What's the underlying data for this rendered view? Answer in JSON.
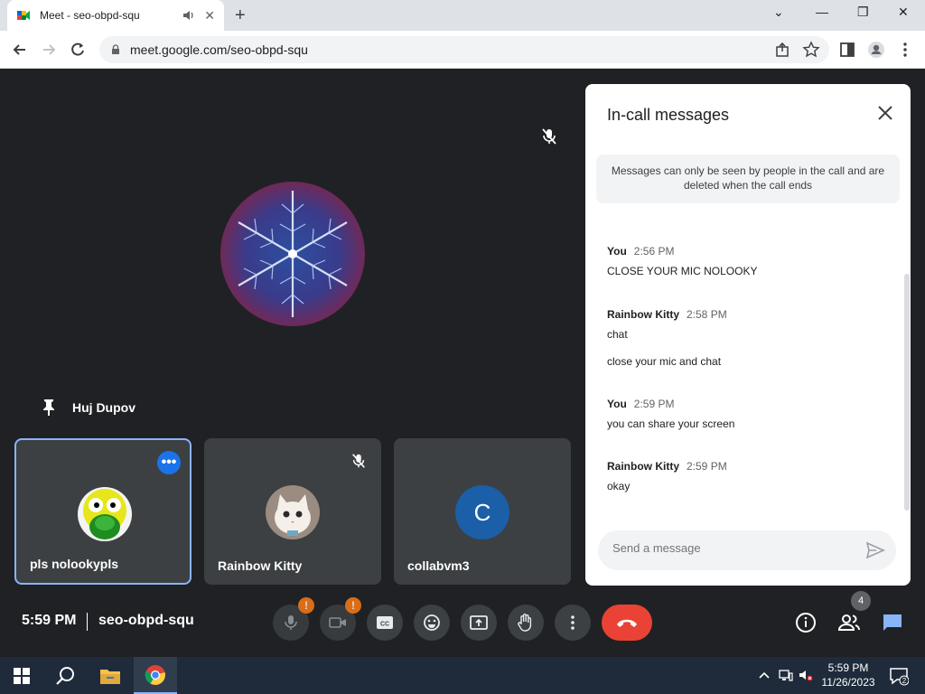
{
  "browser": {
    "tab_title": "Meet - seo-obpd-squ",
    "url": "meet.google.com/seo-obpd-squ"
  },
  "meet": {
    "pinned_name": "Huj Dupov",
    "tiles": [
      {
        "name": "pls nolookypls"
      },
      {
        "name": "Rainbow Kitty"
      },
      {
        "name": "collabvm3",
        "initial": "C"
      }
    ],
    "clock": "5:59 PM",
    "meeting_code": "seo-obpd-squ",
    "participants_count": "4",
    "warning_mark": "!"
  },
  "chat": {
    "title": "In-call messages",
    "notice": "Messages can only be seen by people in the call and are deleted when the call ends",
    "messages": [
      {
        "sender": "You",
        "time": "2:56 PM",
        "lines": [
          "CLOSE YOUR MIC NOLOOKY"
        ]
      },
      {
        "sender": "Rainbow Kitty",
        "time": "2:58 PM",
        "lines": [
          "chat",
          "close your mic and chat"
        ]
      },
      {
        "sender": "You",
        "time": "2:59 PM",
        "lines": [
          "you can share your screen"
        ]
      },
      {
        "sender": "Rainbow Kitty",
        "time": "2:59 PM",
        "lines": [
          "okay"
        ]
      }
    ],
    "input_placeholder": "Send a message"
  },
  "taskbar": {
    "time": "5:59 PM",
    "date": "11/26/2023",
    "notification_count": "2"
  },
  "colors": {
    "meet_bg": "#202124",
    "tile_bg": "#3c4043",
    "accent_blue": "#1a73e8",
    "end_call_red": "#ea4335",
    "warning_orange": "#fa7b17"
  }
}
